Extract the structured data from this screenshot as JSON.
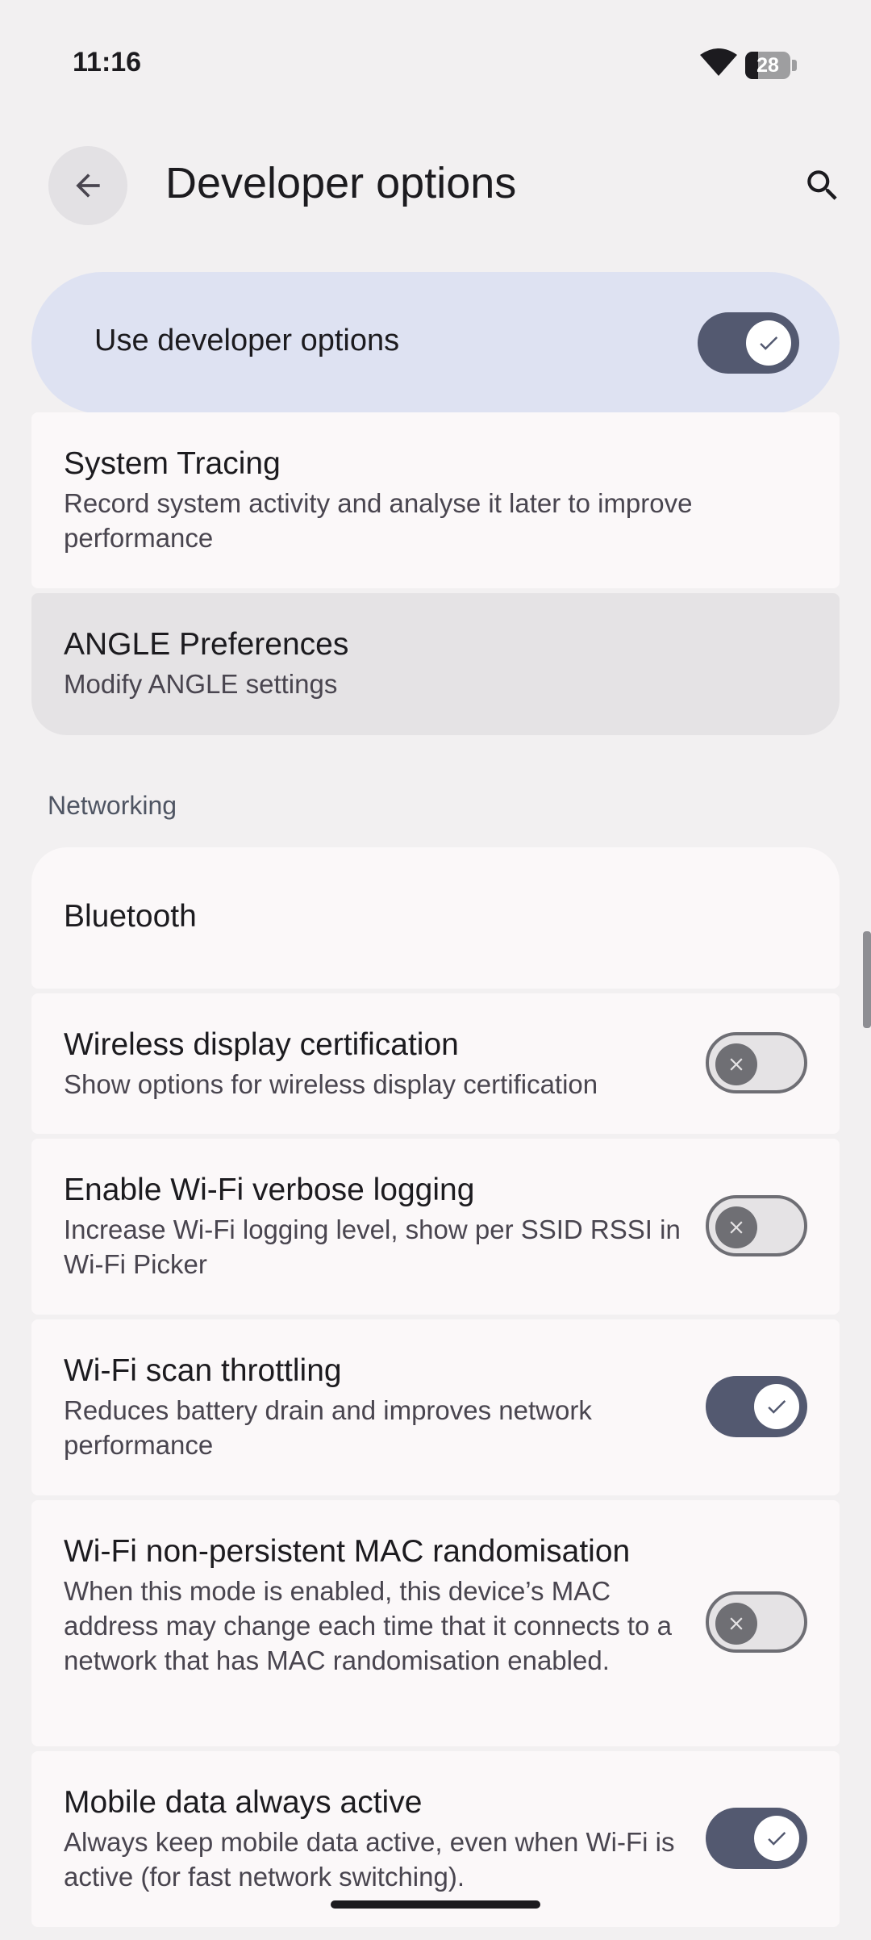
{
  "status_bar": {
    "time": "11:16",
    "battery": "28",
    "battery_level": 0.28
  },
  "header": {
    "title": "Developer options"
  },
  "master_toggle": {
    "label": "Use developer options",
    "on": true
  },
  "items": [
    {
      "title": "System Tracing",
      "subtitle": "Record system activity and analyse it later to improve performance"
    },
    {
      "title": "ANGLE Preferences",
      "subtitle": "Modify ANGLE settings"
    }
  ],
  "section": {
    "title": "Networking"
  },
  "network_items": [
    {
      "title": "Bluetooth"
    },
    {
      "title": "Wireless display certification",
      "subtitle": "Show options for wireless display certification",
      "on": false
    },
    {
      "title": "Enable Wi-Fi verbose logging",
      "subtitle": "Increase Wi-Fi logging level, show per SSID RSSI in Wi-Fi Picker",
      "on": false
    },
    {
      "title": "Wi-Fi scan throttling",
      "subtitle": "Reduces battery drain and improves network performance",
      "on": true
    },
    {
      "title": "Wi-Fi non-persistent MAC randomisation",
      "subtitle": "When this mode is enabled, this device’s MAC address may change each time that it connects to a network that has MAC randomisation enabled.",
      "on": false
    },
    {
      "title": "Mobile data always active",
      "subtitle": "Always keep mobile data active, even when Wi-Fi is active (for fast network switching).",
      "on": true
    }
  ],
  "colors": {
    "accent": "#535970",
    "master_bg": "#dee2f2",
    "card_bg": "#fbf8f9",
    "page_bg": "#f2f0f1"
  },
  "icons": [
    "wifi-icon",
    "battery-icon",
    "back-arrow-icon",
    "search-icon",
    "check-icon",
    "close-icon"
  ]
}
